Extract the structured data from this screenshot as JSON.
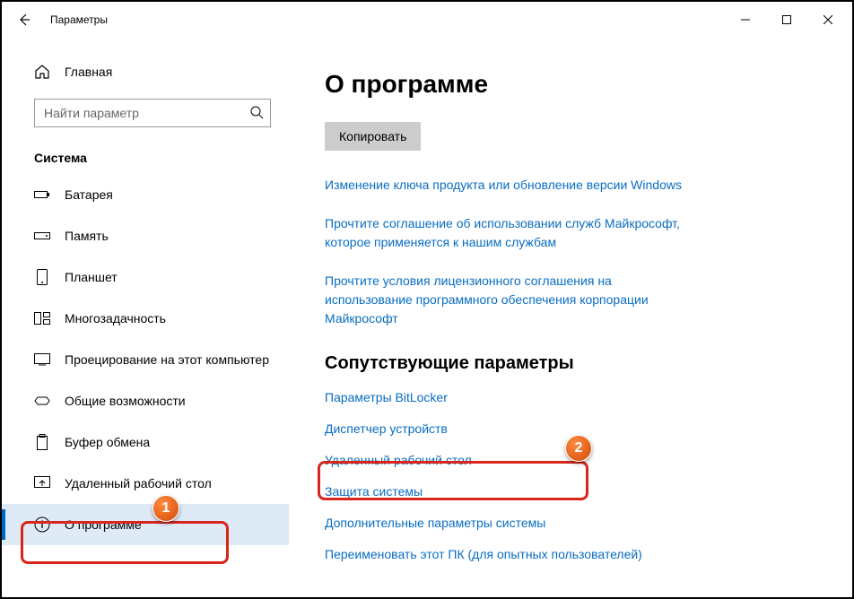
{
  "titlebar": {
    "app_title": "Параметры"
  },
  "sidebar": {
    "home_label": "Главная",
    "search_placeholder": "Найти параметр",
    "section_title": "Система",
    "items": [
      {
        "label": "Батарея"
      },
      {
        "label": "Память"
      },
      {
        "label": "Планшет"
      },
      {
        "label": "Многозадачность"
      },
      {
        "label": "Проецирование на этот компьютер"
      },
      {
        "label": "Общие возможности"
      },
      {
        "label": "Буфер обмена"
      },
      {
        "label": "Удаленный рабочий стол"
      },
      {
        "label": "О программе"
      }
    ]
  },
  "main": {
    "page_title": "О программе",
    "copy_button": "Копировать",
    "links_top": [
      "Изменение ключа продукта или обновление версии Windows",
      "Прочтите соглашение об использовании служб Майкрософт, которое применяется к нашим службам",
      "Прочтите условия лицензионного соглашения на использование программного обеспечения корпорации Майкрософт"
    ],
    "related_heading": "Сопутствующие параметры",
    "related_links": [
      "Параметры BitLocker",
      "Диспетчер устройств",
      "Удаленный рабочий стол",
      "Защита системы",
      "Дополнительные параметры системы",
      "Переименовать этот ПК (для опытных пользователей)"
    ]
  },
  "callouts": {
    "one": "1",
    "two": "2"
  }
}
